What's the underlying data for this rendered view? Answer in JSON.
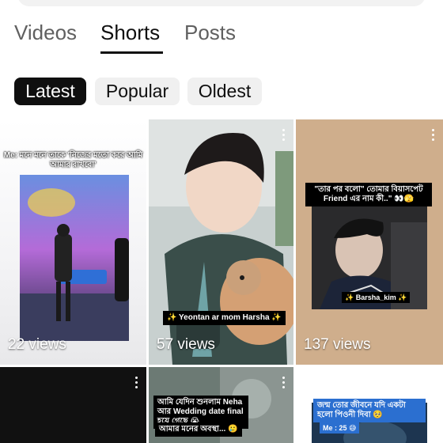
{
  "tabs": [
    {
      "label": "Videos",
      "active": false
    },
    {
      "label": "Shorts",
      "active": true
    },
    {
      "label": "Posts",
      "active": false
    }
  ],
  "filters": [
    {
      "label": "Latest",
      "active": true
    },
    {
      "label": "Popular",
      "active": false
    },
    {
      "label": "Oldest",
      "active": false
    }
  ],
  "shorts": [
    {
      "views": "22 views",
      "caption": "Me: মনে মনে তাকে 'নিজের মতো করে আমি আমার রাখবো'"
    },
    {
      "views": "57 views",
      "caption": "✨ Yeontan ar mom Harsha ✨"
    },
    {
      "views": "137 views",
      "caption_top": "\"তার পর বলো\" তোমার বিয়াসপেট Friend এর নাম কী..\" 👀🫣",
      "caption_bottom": "✨ Barsha_kim ✨"
    },
    {
      "views": "",
      "caption": ""
    },
    {
      "views": "",
      "caption_top": "আমি যেদিন শুনলাম Neha আর Wedding date final হয়ে গেছে 😭",
      "caption_bottom": "আমার মনের অবস্থা... 🥲"
    },
    {
      "views": "",
      "caption_top": "জন্ম তোর জীবনে যদি একটা হলো পিওনী দিবা 🥺",
      "caption_bottom": "Me : 25 😅"
    }
  ],
  "colors": {
    "accent": "#0f0f0f",
    "muted": "#606060",
    "chip_bg": "#f0f0f0"
  }
}
